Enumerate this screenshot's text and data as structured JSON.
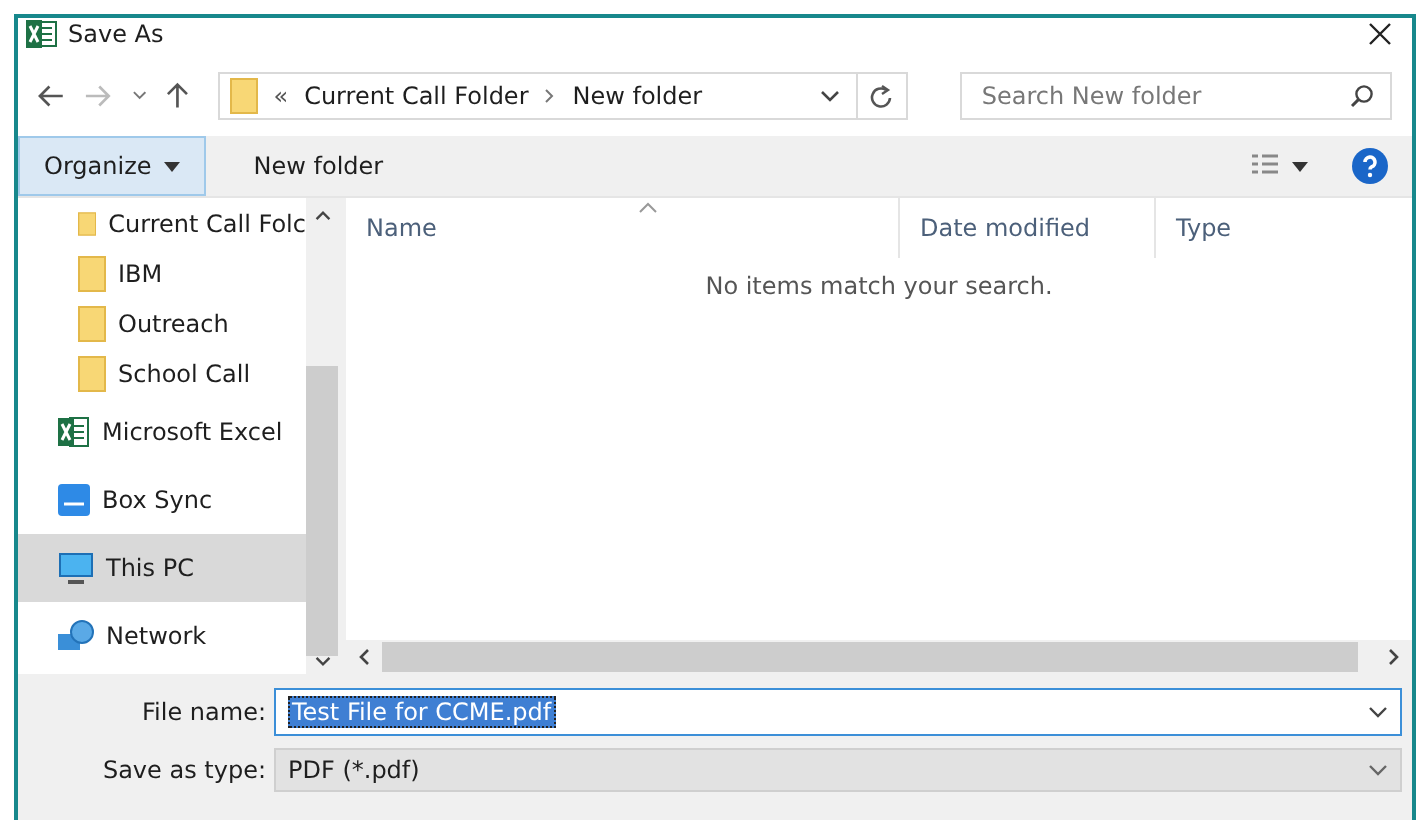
{
  "window": {
    "title": "Save As"
  },
  "address": {
    "overflow": "«",
    "crumbs": [
      "Current Call Folder",
      "New folder"
    ]
  },
  "search": {
    "placeholder": "Search New folder"
  },
  "toolbar": {
    "organize": "Organize",
    "new_folder": "New folder"
  },
  "sidebar": {
    "items": [
      {
        "label": "Current Call Folc",
        "kind": "folder",
        "selected": false
      },
      {
        "label": "IBM",
        "kind": "folder",
        "selected": false
      },
      {
        "label": "Outreach",
        "kind": "folder",
        "selected": false
      },
      {
        "label": "School Call",
        "kind": "folder",
        "selected": false
      },
      {
        "label": "Microsoft Excel",
        "kind": "excel",
        "selected": false
      },
      {
        "label": "Box Sync",
        "kind": "box",
        "selected": false
      },
      {
        "label": "This PC",
        "kind": "pc",
        "selected": true
      },
      {
        "label": "Network",
        "kind": "network",
        "selected": false
      }
    ]
  },
  "table": {
    "columns": [
      "Name",
      "Date modified",
      "Type"
    ],
    "empty_message": "No items match your search."
  },
  "form": {
    "file_name_label": "File name:",
    "file_name": "Test File for CCME.pdf",
    "type_label": "Save as type:",
    "type_value": "PDF (*.pdf)"
  }
}
